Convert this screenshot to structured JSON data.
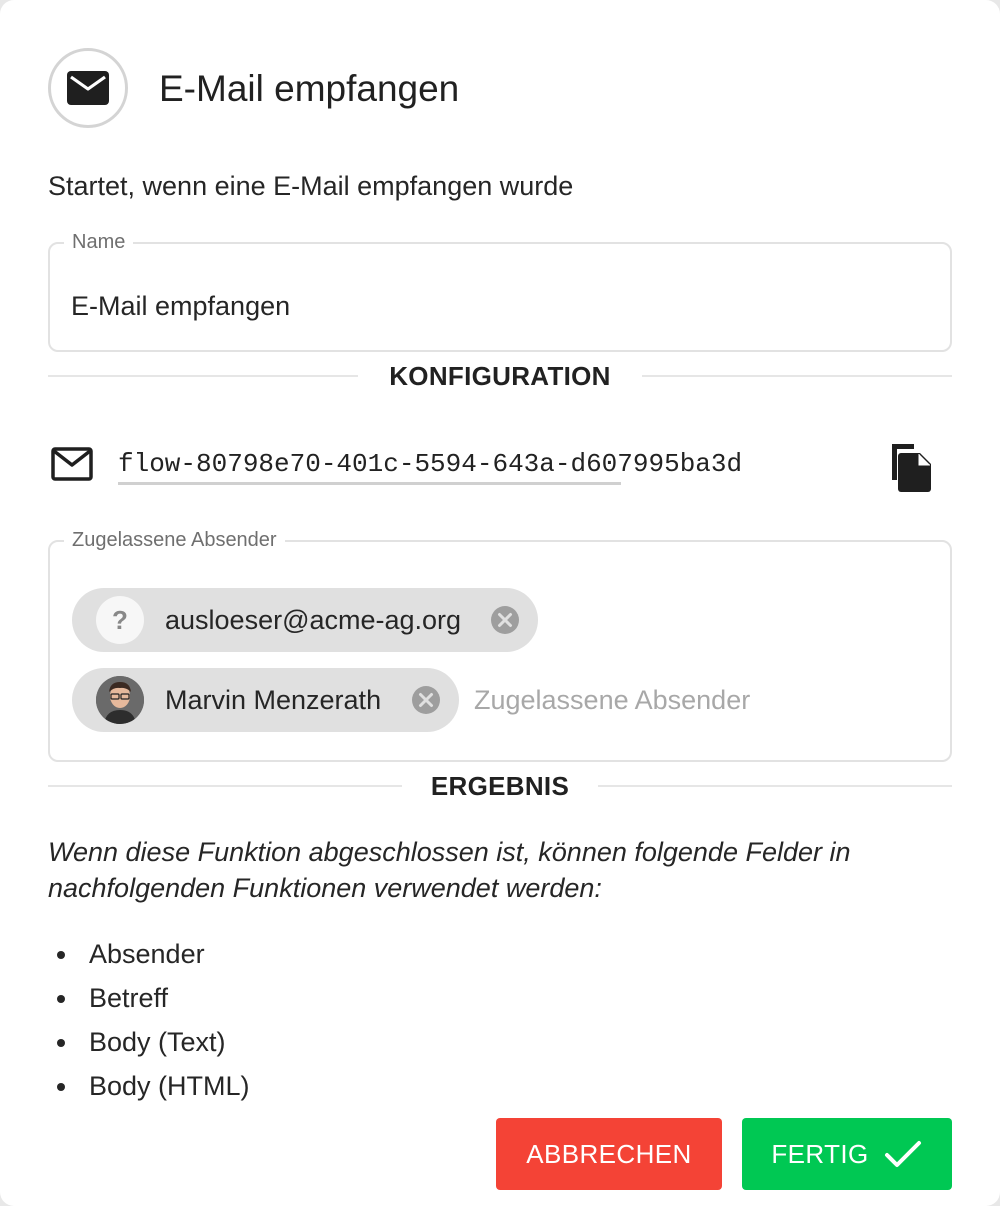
{
  "header": {
    "icon": "mail-icon",
    "title": "E-Mail empfangen"
  },
  "subtitle": "Startet, wenn eine E-Mail empfangen wurde",
  "name_field": {
    "legend": "Name",
    "value": "E-Mail empfangen"
  },
  "config": {
    "section_label": "KONFIGURATION",
    "address_icon": "mail-outline-icon",
    "address": "flow-80798e70-401c-5594-643a-d607995ba3d",
    "copy_icon": "copy-icon"
  },
  "senders": {
    "legend": "Zugelassene Absender",
    "chips": [
      {
        "label": "ausloeser@acme-ag.org",
        "avatar": "?"
      },
      {
        "label": "Marvin Menzerath",
        "avatar": "photo"
      }
    ],
    "placeholder": "Zugelassene Absender"
  },
  "result": {
    "section_label": "ERGEBNIS",
    "description": "Wenn diese Funktion abgeschlossen ist, können folgende Felder in nachfolgenden Funktionen verwendet werden:",
    "fields": [
      "Absender",
      "Betreff",
      "Body (Text)",
      "Body (HTML)"
    ]
  },
  "buttons": {
    "cancel_label": "ABBRECHEN",
    "done_label": "FERTIG"
  },
  "colors": {
    "cancel": "#f44336",
    "done": "#00c853",
    "chip": "#e0e0e0",
    "border": "#e2e2e2"
  }
}
